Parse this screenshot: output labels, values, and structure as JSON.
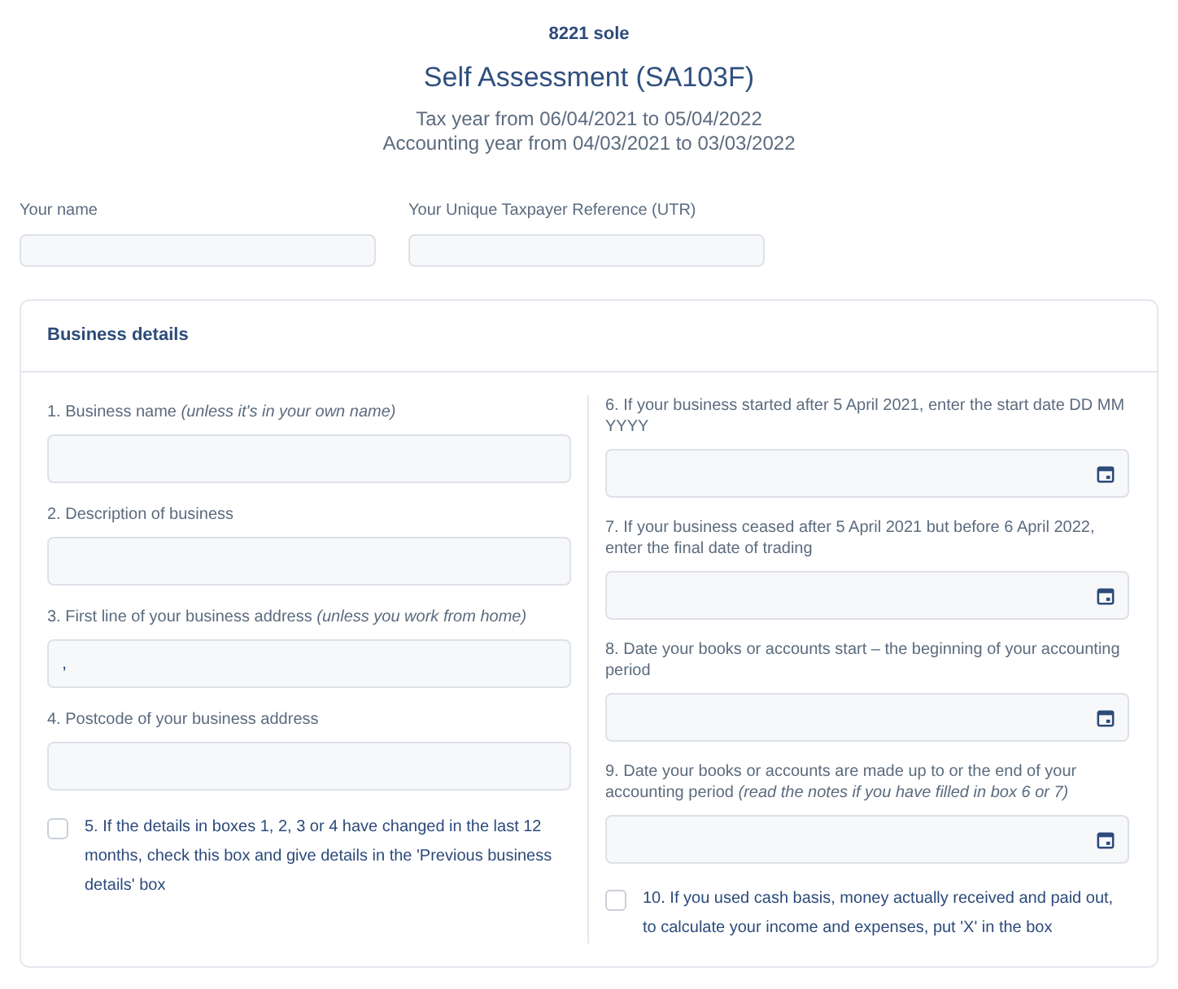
{
  "header": {
    "subtitle": "8221 sole",
    "title": "Self Assessment (SA103F)",
    "lines": [
      "Tax year from 06/04/2021 to 05/04/2022",
      "Accounting year from 04/03/2021 to 03/03/2022"
    ]
  },
  "top_fields": [
    {
      "label": "Your name"
    },
    {
      "label": "Your Unique Taxpayer Reference (UTR)"
    }
  ],
  "card": {
    "title": "Business details",
    "left": [
      {
        "kind": "text",
        "label": "1. Business name *(unless it's in your own name)*"
      },
      {
        "kind": "text",
        "label": "2. Description of business"
      },
      {
        "kind": "text",
        "label": "3. First line of your business address *(unless you work from home)*",
        "value": ","
      },
      {
        "kind": "text",
        "label": "4. Postcode of your business address"
      },
      {
        "kind": "checkbox",
        "label": "5. If the details in boxes 1, 2, 3 or 4 have changed in the last 12 months, check this box and give details in the 'Previous business details' box",
        "checked": false
      }
    ],
    "right": [
      {
        "kind": "date",
        "label": "6. If your business started after 5 April 2021, enter the start date DD MM YYYY"
      },
      {
        "kind": "date",
        "label": "7. If your business ceased after 5 April 2021 but before 6 April 2022, enter the final date of trading"
      },
      {
        "kind": "date",
        "label": "8. Date your books or accounts start – the beginning of your accounting period"
      },
      {
        "kind": "date",
        "label": "9. Date your books or accounts are made up to or the end of your accounting period *(read the notes if you have filled in box 6 or 7)*"
      },
      {
        "kind": "checkbox",
        "label": "10. If you used cash basis, money actually received and paid out, to calculate your income and expenses, put 'X' in the box",
        "checked": false
      }
    ]
  }
}
